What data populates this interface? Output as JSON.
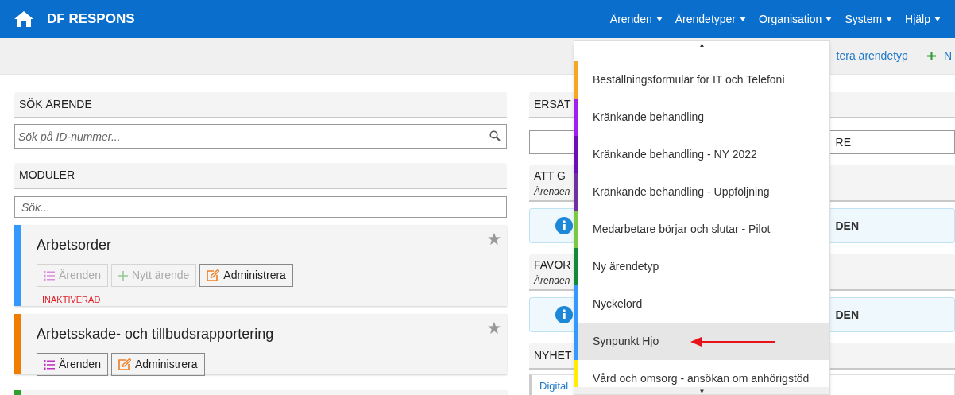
{
  "navbar": {
    "brand": "DF RESPONS",
    "menus": [
      {
        "label": "Ärenden"
      },
      {
        "label": "Ärendetyper"
      },
      {
        "label": "Organisation"
      },
      {
        "label": "System"
      },
      {
        "label": "Hjälp"
      }
    ]
  },
  "toolbar": {
    "links": [
      {
        "label": "tera ärendetyp",
        "kind": "text"
      },
      {
        "label": "N",
        "kind": "add"
      }
    ]
  },
  "search_case": {
    "title": "SÖK ÄRENDE",
    "placeholder": "Sök på ID-nummer..."
  },
  "modules": {
    "title": "MODULER",
    "placeholder": "Sök...",
    "items": [
      {
        "title": "Arbetsorder",
        "color": "#3399ff",
        "status": "INAKTIVERAD",
        "buttons": [
          {
            "label": "Ärenden",
            "kind": "list",
            "disabled": true
          },
          {
            "label": "Nytt ärende",
            "kind": "add",
            "disabled": true
          },
          {
            "label": "Administrera",
            "kind": "edit",
            "disabled": false
          }
        ]
      },
      {
        "title": "Arbetsskade- och tillbudsrapportering",
        "color": "#f07d00",
        "buttons": [
          {
            "label": "Ärenden",
            "kind": "list",
            "disabled": false
          },
          {
            "label": "Administrera",
            "kind": "edit",
            "disabled": false
          }
        ]
      },
      {
        "color": "#2ea02e"
      }
    ]
  },
  "right_column": {
    "panels": [
      {
        "kind": "header",
        "title": "ERSÄT"
      },
      {
        "kind": "field",
        "value": "RE"
      },
      {
        "kind": "header",
        "title": "ATT G",
        "subtitle": "Ärenden"
      },
      {
        "kind": "info",
        "text": "DEN"
      },
      {
        "kind": "header",
        "title": "FAVOR",
        "subtitle": "Ärenden"
      },
      {
        "kind": "info",
        "text": "DEN"
      },
      {
        "kind": "header",
        "title": "NYHET"
      },
      {
        "kind": "link",
        "text": "Digital"
      }
    ]
  },
  "dropdown": {
    "scroll_up": "▲",
    "scroll_down": "▼",
    "items": [
      {
        "label": "Beställningsformulär för IT och Telefoni",
        "color": "#f5a623",
        "selected": false
      },
      {
        "label": "Kränkande behandling",
        "color": "#a020f0",
        "selected": false
      },
      {
        "label": "Kränkande behandling - NY 2022",
        "color": "#6a0dbb",
        "selected": false
      },
      {
        "label": "Kränkande behandling - Uppföljning",
        "color": "#7030a0",
        "selected": false
      },
      {
        "label": "Medarbetare börjar och slutar - Pilot",
        "color": "#7ac943",
        "selected": false
      },
      {
        "label": "Ny ärendetyp",
        "color": "#138a36",
        "selected": false
      },
      {
        "label": "Nyckelord",
        "color": "#3399ff",
        "selected": false
      },
      {
        "label": "Synpunkt Hjo",
        "color": "#3399ff",
        "selected": true
      },
      {
        "label": "Vård och omsorg - ansökan om anhörigstöd",
        "color": "#ffee00",
        "selected": false
      }
    ]
  }
}
